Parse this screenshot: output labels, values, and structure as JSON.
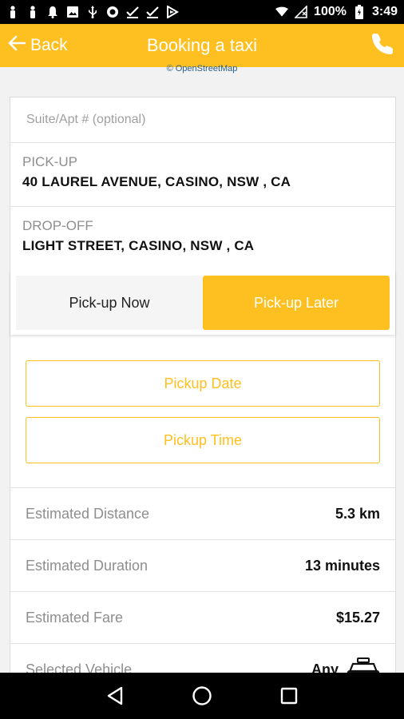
{
  "status_bar": {
    "battery": "100%",
    "time": "3:49",
    "icons": [
      "person-icon",
      "person-icon",
      "bell-icon",
      "image-icon",
      "usb-icon",
      "circle-icon",
      "check-icon",
      "check-icon",
      "play-icon",
      "wifi-icon",
      "no-signal-icon",
      "battery-icon"
    ]
  },
  "app_bar": {
    "back_label": "Back",
    "title": "Booking a taxi",
    "call_icon": "phone-icon"
  },
  "map": {
    "attribution": "© OpenStreetMap"
  },
  "form": {
    "suite_placeholder": "Suite/Apt # (optional)",
    "pickup_label": "PICK-UP",
    "pickup_value": "40 LAUREL AVENUE, CASINO, NSW , CA",
    "dropoff_label": "DROP-OFF",
    "dropoff_value": "LIGHT STREET, CASINO, NSW , CA"
  },
  "segment": {
    "now_label": "Pick-up Now",
    "later_label": "Pick-up Later",
    "selected": "later"
  },
  "pickers": {
    "date_label": "Pickup Date",
    "time_label": "Pickup Time"
  },
  "estimates": {
    "distance_label": "Estimated Distance",
    "distance_value": "5.3 km",
    "duration_label": "Estimated Duration",
    "duration_value": "13 minutes",
    "fare_label": "Estimated Fare",
    "fare_value": "$15.27",
    "vehicle_label": "Selected Vehicle",
    "vehicle_value": "Any",
    "vehicle_icon": "taxi-icon"
  },
  "colors": {
    "accent": "#fdc020",
    "status_bar": "#000000",
    "nav_bar": "#000000"
  }
}
